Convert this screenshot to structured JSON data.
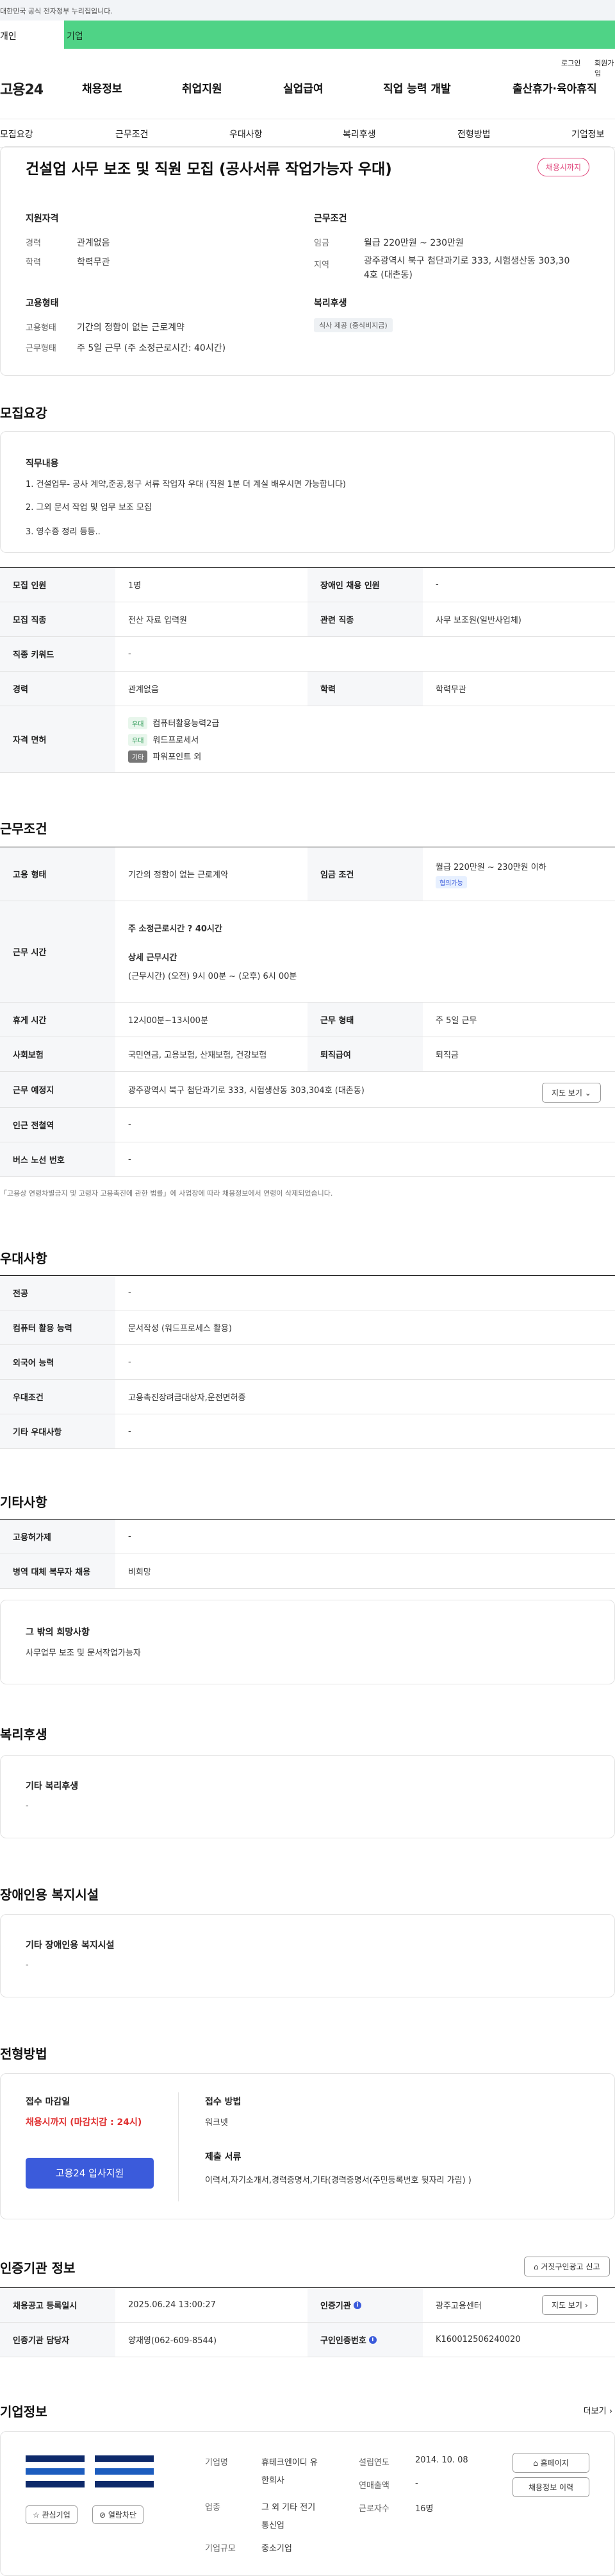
{
  "gov_notice": "대한민국 공식 전자정부 누리집입니다.",
  "user_tabs": [
    "개인",
    "기업"
  ],
  "util_links": [
    "로그인",
    "회원가입"
  ],
  "logo": "고용24",
  "gnb": [
    "채용정보",
    "취업지원",
    "실업급여",
    "직업 능력 개발",
    "출산휴가·육아휴직"
  ],
  "subnav": [
    "모집요강",
    "근무조건",
    "우대사항",
    "복리후생",
    "전형방법",
    "기업정보"
  ],
  "job": {
    "title": "건설업 사무 보조 및 직원 모집 (공사서류 작업가능자 우대)",
    "deadline_badge": "채용시까지",
    "summary": {
      "qual_head": "지원자격",
      "career_k": "경력",
      "career_v": "관계없음",
      "edu_k": "학력",
      "edu_v": "학력무관",
      "cond_head": "근무조건",
      "wage_k": "임금",
      "wage_v": "월급 220만원 ~ 230만원",
      "region_k": "지역",
      "region_v1": "광주광역시 북구 첨단과기로 333, 시험생산동 303,30",
      "region_v2": "4호 (대촌동)",
      "emp_head": "고용형태",
      "emp_k": "고용형태",
      "emp_v": "기간의 정함이 없는 근로계약",
      "work_k": "근무형태",
      "work_v": "주 5일 근무 (주 소정근로시간: 40시간)",
      "welfare_head": "복리후생",
      "welfare_chip": "식사 제공 (중식비지급)"
    }
  },
  "recruit": {
    "title": "모집요강",
    "duty_head": "직무내용",
    "duties": [
      "1.  건설업무- 공사 계약,준공,청구 서류 작업자 우대 (직원 1분 더 계실 배우시면 가능합니다)",
      "2. 그외 문서 작업 및 업무 보조 모집",
      "3. 영수증 정리 등등.."
    ],
    "headcount_k": "모집 인원",
    "headcount_v": "1명",
    "disabled_k": "장애인 채용 인원",
    "disabled_v": "-",
    "job_k": "모집 직종",
    "job_v": "전산 자료 입력원",
    "related_k": "관련 직종",
    "related_v": "사무 보조원(일반사업체)",
    "keyword_k": "직종 키워드",
    "keyword_v": "-",
    "career_k": "경력",
    "career_v": "관계없음",
    "edu_k": "학력",
    "edu_v": "학력무관",
    "license_k": "자격 면허",
    "licenses": [
      {
        "tag": "우대",
        "name": "컴퓨터활용능력2급"
      },
      {
        "tag": "우대",
        "name": "워드프로세서"
      },
      {
        "tag": "기타",
        "name": "파워포인트 외"
      }
    ]
  },
  "conditions": {
    "title": "근무조건",
    "emp_k": "고용 형태",
    "emp_v": "기간의 정함이 없는 근로계약",
    "wage_k": "임금 조건",
    "wage_v": "월급 220만원 ~ 230만원 이하",
    "wage_tag": "협의가능",
    "time_k": "근무 시간",
    "time_hours": "주 소정근로시간 ? 40시간",
    "time_detail_h": "상세 근무시간",
    "time_detail_v": "(근무시간) (오전) 9시 00분 ~ (오후) 6시 00분",
    "break_k": "휴게 시간",
    "break_v": "12시00분~13시00분",
    "worktype_k": "근무 형태",
    "worktype_v": "주 5일 근무",
    "insure_k": "사회보험",
    "insure_v": "국민연금, 고용보험, 산재보험, 건강보험",
    "severance_k": "퇴직급여",
    "severance_v": "퇴직금",
    "place_k": "근무 예정지",
    "place_v": "광주광역시 북구 첨단과기로 333, 시험생산동 303,304호 (대촌동)",
    "map_btn": "지도 보기 ⌄",
    "station_k": "인근 전철역",
    "station_v": "-",
    "bus_k": "버스 노선 번호",
    "bus_v": "-",
    "note": "「고용상 연령차별금지 및 고령자 고용촉진에 관한 법률」에 사업장에 따라 채용정보에서 연령이 삭제되었습니다."
  },
  "preference": {
    "title": "우대사항",
    "major_k": "전공",
    "major_v": "-",
    "computer_k": "컴퓨터 활용 능력",
    "computer_v": "문서작성 (워드프로세스 활용)",
    "lang_k": "외국어 능력",
    "lang_v": "-",
    "cond_k": "우대조건",
    "cond_v": "고용촉진장려금대상자,운전면허증",
    "etc_k": "기타 우대사항",
    "etc_v": "-"
  },
  "other": {
    "title": "기타사항",
    "promo_k": "고용허가제",
    "promo_v": "-",
    "military_k": "병역 대체 복무자 채용",
    "military_v": "비희망",
    "extra_head": "그 밖의 희망사항",
    "extra_v": "사무업무 보조 및 문서작업가능자"
  },
  "welfare": {
    "title": "복리후생",
    "head": "기타 복리후생",
    "value": "-"
  },
  "disability": {
    "title": "장애인용 복지시설",
    "head": "기타 장애인용 복지시설",
    "value": "-"
  },
  "selection": {
    "title": "전형방법",
    "deadline_h": "접수 마감일",
    "deadline_v": "채용시까지 (마감치감 : 24시)",
    "apply_btn": "고용24 입사지원",
    "method_h": "접수 방법",
    "method_v": "워크넷",
    "docs_h": "제출 서류",
    "docs_v": "이력서,자기소개서,경력증명서,기타(경력증명서(주민등록번호 뒷자리 가림) )"
  },
  "agency": {
    "title": "인증기관 정보",
    "report_btn": "거짓구인광고 신고",
    "reg_k": "채용공고 등록일시",
    "reg_v": "2025.06.24 13:00:27",
    "agency_k": "인증기관",
    "agency_v": "광주고용센터",
    "map_btn": "지도 보기",
    "staff_k": "인증기관 담당자",
    "staff_v": "양재영(062-609-8544)",
    "notice_k": "구인인증번호",
    "notice_v": "K160012506240020"
  },
  "company": {
    "title": "기업정보",
    "more": "더보기",
    "interest_btn": "관심기업",
    "block_btn": "열람차단",
    "name_k": "기업명",
    "name_v1": "휴테크엔이디 유",
    "name_v2": "한회사",
    "industry_k": "업종",
    "industry_v1": "그 외 기타 전기",
    "industry_v2": "통신업",
    "size_k": "기업규모",
    "size_v": "중소기업",
    "founded_k": "설립연도",
    "founded_v": "2014. 10. 08",
    "sales_k": "연매출액",
    "sales_v": "-",
    "employees_k": "근로자수",
    "employees_v": "16명",
    "homepage_btn": "홈페이지",
    "jobs_btn": "채용정보 이력"
  }
}
